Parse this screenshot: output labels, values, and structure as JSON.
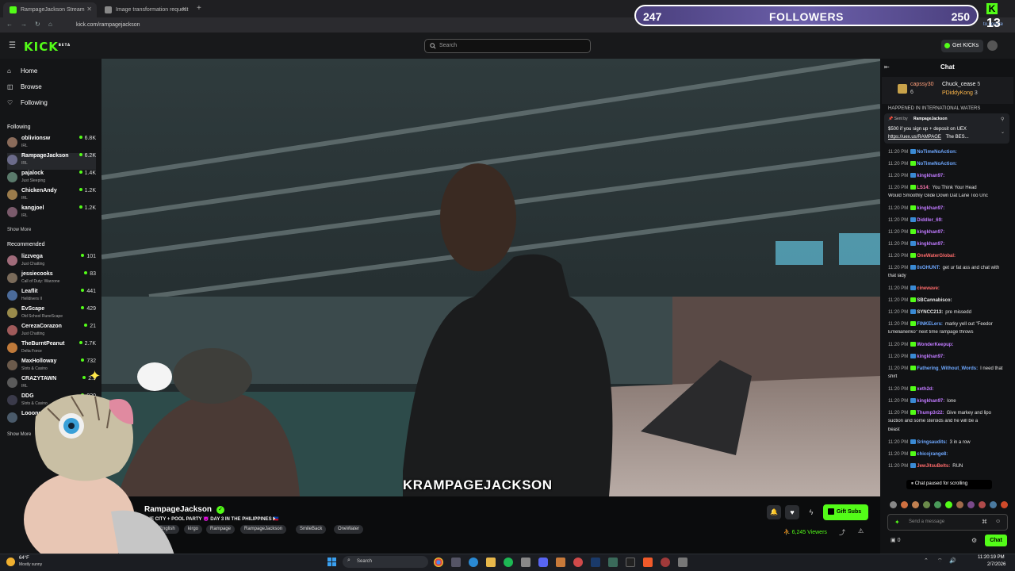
{
  "browser": {
    "tabs": [
      {
        "title": "RampageJackson Stream"
      },
      {
        "title": "Image transformation request"
      }
    ],
    "url": "kick.com/rampagejackson",
    "update_label": "to update"
  },
  "header": {
    "logo": "KICK",
    "logo_sup": "BETA",
    "search_placeholder": "Search",
    "get_kicks": "Get KICKs"
  },
  "sidebar": {
    "nav": [
      {
        "label": "Home"
      },
      {
        "label": "Browse"
      },
      {
        "label": "Following"
      }
    ],
    "following_title": "Following",
    "following": [
      {
        "name": "oblivionsw",
        "category": "IRL",
        "viewers": "6.8K",
        "color": "#8a6b5a"
      },
      {
        "name": "RampageJackson",
        "category": "IRL",
        "viewers": "6.2K",
        "color": "#6b6b8a"
      },
      {
        "name": "pajalock",
        "category": "Just Sleeping",
        "viewers": "1.4K",
        "color": "#5a7a6b"
      },
      {
        "name": "ChickenAndy",
        "category": "IRL",
        "viewers": "1.2K",
        "color": "#9a7b4b"
      },
      {
        "name": "kangjoel",
        "category": "IRL",
        "viewers": "1.2K",
        "color": "#7a5a6b"
      }
    ],
    "show_more": "Show More",
    "recommended_title": "Recommended",
    "recommended": [
      {
        "name": "lizzvega",
        "category": "Just Chatting",
        "viewers": "101",
        "color": "#a06b7a"
      },
      {
        "name": "jessiecooks",
        "category": "Call of Duty: Warzone",
        "viewers": "83",
        "color": "#7a6b5a"
      },
      {
        "name": "Leaflit",
        "category": "Helldivers II",
        "viewers": "441",
        "color": "#4b6b9a"
      },
      {
        "name": "EvScape",
        "category": "Old School RuneScape",
        "viewers": "429",
        "color": "#9a8b4b"
      },
      {
        "name": "CerezaCorazon",
        "category": "Just Chatting",
        "viewers": "21",
        "color": "#a05a5a"
      },
      {
        "name": "TheBurntPeanut",
        "category": "Delta Force",
        "viewers": "2.7K",
        "color": "#c07a3a"
      },
      {
        "name": "MaxHolloway",
        "category": "Slots & Casino",
        "viewers": "732",
        "color": "#6b5a4b"
      },
      {
        "name": "CRAZYTAWN",
        "category": "IRL",
        "viewers": "2.9",
        "color": "#5a5a5a"
      },
      {
        "name": "DDG",
        "category": "Slots & Casino",
        "viewers": "920",
        "color": "#3a3a4a"
      },
      {
        "name": "Looonn",
        "category": "",
        "viewers": "",
        "color": "#4a5a6a"
      }
    ],
    "show_more_2": "Show More"
  },
  "video": {
    "caption": "KRAMPAGEJACKSON"
  },
  "stream": {
    "streamer": "RampageJackson",
    "title": "THE CITY + POOL PARTY 😈 DAY 3 IN THE PHILIPPINES 🇵🇭",
    "tags": [
      "English",
      "kirgo",
      "Rampage",
      "RampageJackson",
      "SmileBack",
      "OneWater"
    ],
    "viewers": "6,245 Viewers",
    "gift_subs": "Gift Subs"
  },
  "chat": {
    "title": "Chat",
    "pinned_leaders": [
      {
        "name": "capssy30",
        "count": "6"
      },
      {
        "name": "Chuck_cease",
        "count": "5"
      },
      {
        "name": "PDiddyKong",
        "count": "3"
      }
    ],
    "pinned_top": "HAPPENED IN INTERNATIONAL WATERS",
    "pinned_sent_by": "Sent by",
    "pinned_sender": "RampageJackson",
    "pinned_text": "$500 if you sign up + deposit on UEX",
    "pinned_link": "https://uex.us/RAMPAGE",
    "pinned_link_suffix": "The BES...",
    "messages": [
      {
        "time": "11:20 PM",
        "user": "NoTimeNoAction:",
        "text": "",
        "color": "#6ea8ff"
      },
      {
        "time": "11:20 PM",
        "user": "NoTimeNoAction:",
        "text": "",
        "color": "#6ea8ff"
      },
      {
        "time": "11:20 PM",
        "user": "kingkhan97:",
        "text": "",
        "color": "#c07aff"
      },
      {
        "time": "11:20 PM",
        "user": "LS14:",
        "text": "You Think Your Head",
        "color": "#ff7ab0"
      },
      {
        "time": "",
        "user": "",
        "text": "Would Smoothly Glide Down Dat Lane Too Unc",
        "color": "#fff"
      },
      {
        "time": "11:20 PM",
        "user": "kingkhan97:",
        "text": "",
        "color": "#c07aff"
      },
      {
        "time": "11:20 PM",
        "user": "Diddler_69:",
        "text": "",
        "color": "#c07aff"
      },
      {
        "time": "11:20 PM",
        "user": "kingkhan97:",
        "text": "",
        "color": "#c07aff"
      },
      {
        "time": "11:20 PM",
        "user": "kingkhan97:",
        "text": "",
        "color": "#c07aff"
      },
      {
        "time": "11:20 PM",
        "user": "OneWaterGlobal:",
        "text": "",
        "color": "#ff6b6b"
      },
      {
        "time": "11:20 PM",
        "user": "0xOHUNT:",
        "text": "get ur fat ass and chat with",
        "color": "#6ea8ff"
      },
      {
        "time": "",
        "user": "",
        "text": "that lady",
        "color": "#fff"
      },
      {
        "time": "11:20 PM",
        "user": "cinewave:",
        "text": "",
        "color": "#ff6b6b"
      },
      {
        "time": "11:20 PM",
        "user": "SBCannabisco:",
        "text": "",
        "color": "#e5e5e5"
      },
      {
        "time": "11:20 PM",
        "user": "SYNCC213:",
        "text": "pre missedd",
        "color": "#e5e5e5"
      },
      {
        "time": "11:20 PM",
        "user": "FINKELers:",
        "text": "marky yell out \"Feedor",
        "color": "#6ea8ff"
      },
      {
        "time": "",
        "user": "",
        "text": "Emelianenko\" next time rampage throws",
        "color": "#fff"
      },
      {
        "time": "11:20 PM",
        "user": "WonderKeepup:",
        "text": "",
        "color": "#c07aff"
      },
      {
        "time": "11:20 PM",
        "user": "kingkhan97:",
        "text": "",
        "color": "#c07aff"
      },
      {
        "time": "11:20 PM",
        "user": "Fathering_Without_Words:",
        "text": "I need that",
        "color": "#6ea8ff"
      },
      {
        "time": "",
        "user": "",
        "text": "shirt",
        "color": "#fff"
      },
      {
        "time": "11:20 PM",
        "user": "xeth2d:",
        "text": "",
        "color": "#c07aff"
      },
      {
        "time": "11:20 PM",
        "user": "kingkhan97:",
        "text": "lone",
        "color": "#c07aff"
      },
      {
        "time": "11:20 PM",
        "user": "Thump3r22:",
        "text": "Give markey and lipo",
        "color": "#c07aff"
      },
      {
        "time": "",
        "user": "",
        "text": "suction and some steroids and he will be a",
        "color": "#fff"
      },
      {
        "time": "",
        "user": "",
        "text": "beast",
        "color": "#fff"
      },
      {
        "time": "11:20 PM",
        "user": "Sringsaudits:",
        "text": "3 in a row",
        "color": "#6ea8ff"
      },
      {
        "time": "11:20 PM",
        "user": "chicojrange8:",
        "text": "",
        "color": "#6ea8ff"
      },
      {
        "time": "11:20 PM",
        "user": "JewJitsuBelts:",
        "text": "RUN",
        "color": "#ff6b6b"
      }
    ],
    "paused": "Chat paused for scrolling",
    "input_placeholder": "Send a message",
    "send_label": "Chat",
    "points": "0"
  },
  "overlay": {
    "followers_left": "247",
    "followers_label": "FOLLOWERS",
    "followers_right": "250",
    "kick_count": "13"
  },
  "taskbar": {
    "weather_temp": "64°F",
    "weather_desc": "Mostly sunny",
    "search": "Search",
    "time": "11:20:19 PM",
    "date": "2/7/2026"
  },
  "colors": {
    "kick_green": "#53fc18",
    "chat_bg": "#111214",
    "sidebar_bg": "#141517"
  }
}
